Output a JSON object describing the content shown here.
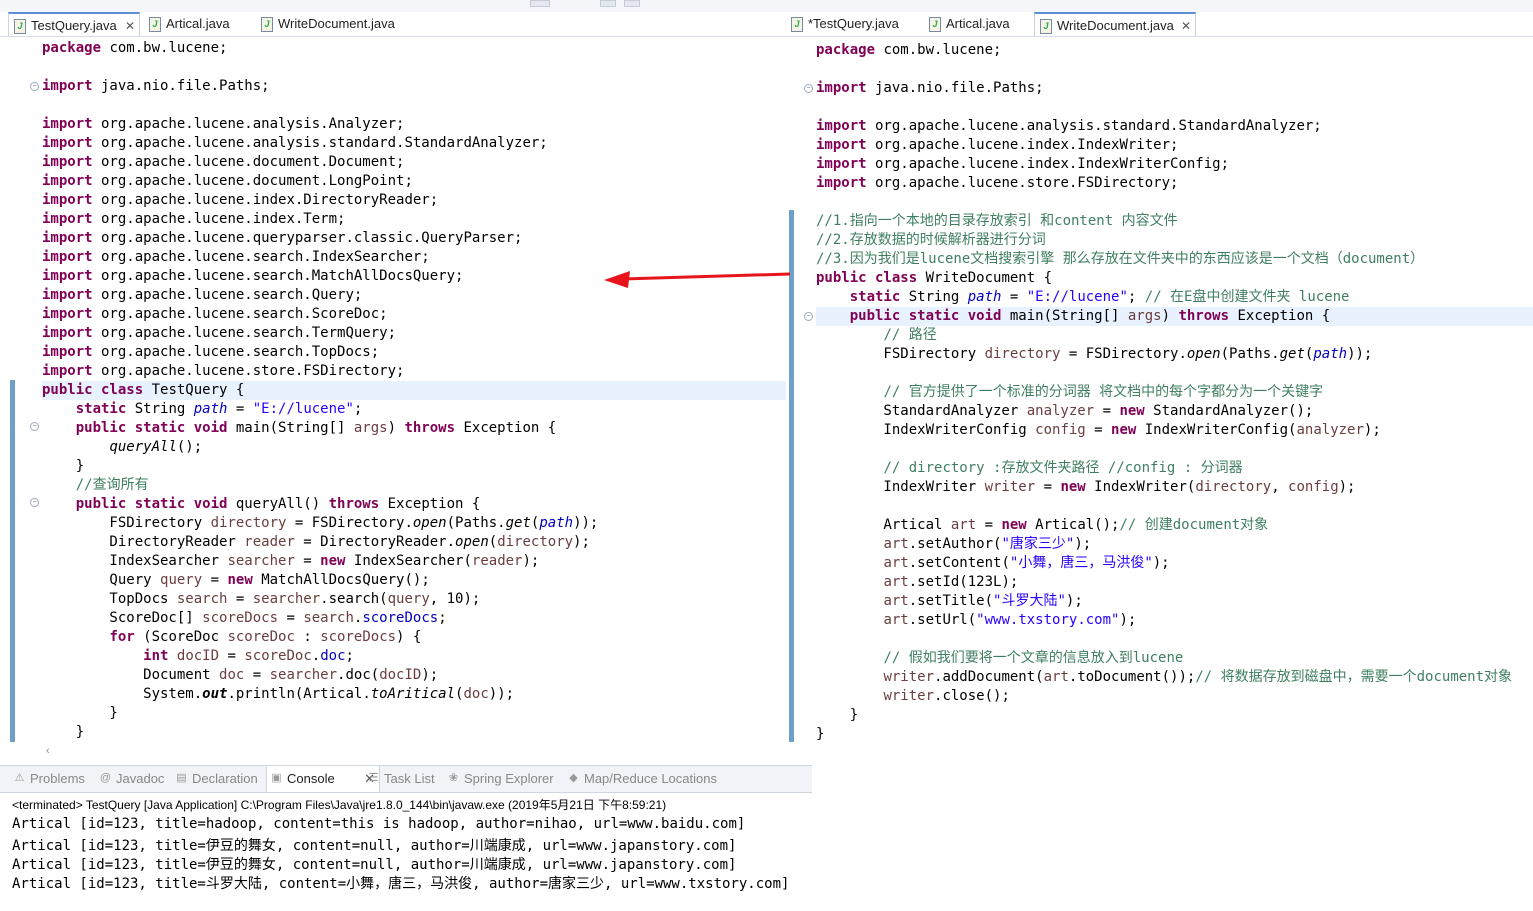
{
  "left_editor": {
    "tabs": [
      {
        "label": "TestQuery.java",
        "active": true,
        "closable": true
      },
      {
        "label": "Artical.java",
        "active": false
      },
      {
        "label": "WriteDocument.java",
        "active": false
      }
    ]
  },
  "right_editor": {
    "tabs": [
      {
        "label": "*TestQuery.java",
        "active": false
      },
      {
        "label": "Artical.java",
        "active": false
      },
      {
        "label": "WriteDocument.java",
        "active": true,
        "closable": true
      }
    ]
  },
  "left_code": [
    [
      [
        "kw",
        "package"
      ],
      [
        "t",
        " com.bw.lucene;"
      ]
    ],
    [],
    [
      [
        "kw",
        "import"
      ],
      [
        "t",
        " java.nio.file.Paths;"
      ]
    ],
    [],
    [
      [
        "kw",
        "import"
      ],
      [
        "t",
        " org.apache.lucene.analysis.Analyzer;"
      ]
    ],
    [
      [
        "kw",
        "import"
      ],
      [
        "t",
        " org.apache.lucene.analysis.standard.StandardAnalyzer;"
      ]
    ],
    [
      [
        "kw",
        "import"
      ],
      [
        "t",
        " org.apache.lucene.document.Document;"
      ]
    ],
    [
      [
        "kw",
        "import"
      ],
      [
        "t",
        " org.apache.lucene.document.LongPoint;"
      ]
    ],
    [
      [
        "kw",
        "import"
      ],
      [
        "t",
        " org.apache.lucene.index.DirectoryReader;"
      ]
    ],
    [
      [
        "kw",
        "import"
      ],
      [
        "t",
        " org.apache.lucene.index.Term;"
      ]
    ],
    [
      [
        "kw",
        "import"
      ],
      [
        "t",
        " org.apache.lucene.queryparser.classic.QueryParser;"
      ]
    ],
    [
      [
        "kw",
        "import"
      ],
      [
        "t",
        " org.apache.lucene.search.IndexSearcher;"
      ]
    ],
    [
      [
        "kw",
        "import"
      ],
      [
        "t",
        " org.apache.lucene.search.MatchAllDocsQuery;"
      ]
    ],
    [
      [
        "kw",
        "import"
      ],
      [
        "t",
        " org.apache.lucene.search.Query;"
      ]
    ],
    [
      [
        "kw",
        "import"
      ],
      [
        "t",
        " org.apache.lucene.search.ScoreDoc;"
      ]
    ],
    [
      [
        "kw",
        "import"
      ],
      [
        "t",
        " org.apache.lucene.search.TermQuery;"
      ]
    ],
    [
      [
        "kw",
        "import"
      ],
      [
        "t",
        " org.apache.lucene.search.TopDocs;"
      ]
    ],
    [
      [
        "kw",
        "import"
      ],
      [
        "t",
        " org.apache.lucene.store.FSDirectory;"
      ]
    ],
    [
      [
        "kw",
        "public class"
      ],
      [
        "t",
        " TestQuery {"
      ]
    ],
    [
      [
        "t",
        "    "
      ],
      [
        "kw",
        "static"
      ],
      [
        "t",
        " String "
      ],
      [
        "fldi",
        "path"
      ],
      [
        "t",
        " = "
      ],
      [
        "str",
        "\"E://lucene\""
      ],
      [
        "t",
        ";"
      ]
    ],
    [
      [
        "t",
        "    "
      ],
      [
        "kw",
        "public static void"
      ],
      [
        "t",
        " main(String[] "
      ],
      [
        "var",
        "args"
      ],
      [
        "t",
        ") "
      ],
      [
        "kw",
        "throws"
      ],
      [
        "t",
        " Exception {"
      ]
    ],
    [
      [
        "t",
        "        "
      ],
      [
        "it",
        "queryAll"
      ],
      [
        "t",
        "();"
      ]
    ],
    [
      [
        "t",
        "    }"
      ]
    ],
    [
      [
        "t",
        "    "
      ],
      [
        "cm",
        "//查询所有"
      ]
    ],
    [
      [
        "t",
        "    "
      ],
      [
        "kw",
        "public static void"
      ],
      [
        "t",
        " queryAll() "
      ],
      [
        "kw",
        "throws"
      ],
      [
        "t",
        " Exception {"
      ]
    ],
    [
      [
        "t",
        "        FSDirectory "
      ],
      [
        "var",
        "directory"
      ],
      [
        "t",
        " = FSDirectory."
      ],
      [
        "it",
        "open"
      ],
      [
        "t",
        "(Paths."
      ],
      [
        "it",
        "get"
      ],
      [
        "t",
        "("
      ],
      [
        "fldi",
        "path"
      ],
      [
        "t",
        "));"
      ]
    ],
    [
      [
        "t",
        "        DirectoryReader "
      ],
      [
        "var",
        "reader"
      ],
      [
        "t",
        " = DirectoryReader."
      ],
      [
        "it",
        "open"
      ],
      [
        "t",
        "("
      ],
      [
        "var",
        "directory"
      ],
      [
        "t",
        ");"
      ]
    ],
    [
      [
        "t",
        "        IndexSearcher "
      ],
      [
        "var",
        "searcher"
      ],
      [
        "t",
        " = "
      ],
      [
        "kw",
        "new"
      ],
      [
        "t",
        " IndexSearcher("
      ],
      [
        "var",
        "reader"
      ],
      [
        "t",
        ");"
      ]
    ],
    [
      [
        "t",
        "        Query "
      ],
      [
        "var",
        "query"
      ],
      [
        "t",
        " = "
      ],
      [
        "kw",
        "new"
      ],
      [
        "t",
        " MatchAllDocsQuery();"
      ]
    ],
    [
      [
        "t",
        "        TopDocs "
      ],
      [
        "var",
        "search"
      ],
      [
        "t",
        " = "
      ],
      [
        "var",
        "searcher"
      ],
      [
        "t",
        ".search("
      ],
      [
        "var",
        "query"
      ],
      [
        "t",
        ", 10);"
      ]
    ],
    [
      [
        "t",
        "        ScoreDoc[] "
      ],
      [
        "var",
        "scoreDocs"
      ],
      [
        "t",
        " = "
      ],
      [
        "var",
        "search"
      ],
      [
        "t",
        "."
      ],
      [
        "fld",
        "scoreDocs"
      ],
      [
        "t",
        ";"
      ]
    ],
    [
      [
        "t",
        "        "
      ],
      [
        "kw",
        "for"
      ],
      [
        "t",
        " (ScoreDoc "
      ],
      [
        "var",
        "scoreDoc"
      ],
      [
        "t",
        " : "
      ],
      [
        "var",
        "scoreDocs"
      ],
      [
        "t",
        ") {"
      ]
    ],
    [
      [
        "t",
        "            "
      ],
      [
        "kw",
        "int"
      ],
      [
        "t",
        " "
      ],
      [
        "var",
        "docID"
      ],
      [
        "t",
        " = "
      ],
      [
        "var",
        "scoreDoc"
      ],
      [
        "t",
        "."
      ],
      [
        "fld",
        "doc"
      ],
      [
        "t",
        ";"
      ]
    ],
    [
      [
        "t",
        "            Document "
      ],
      [
        "var",
        "doc"
      ],
      [
        "t",
        " = "
      ],
      [
        "var",
        "searcher"
      ],
      [
        "t",
        ".doc("
      ],
      [
        "var",
        "docID"
      ],
      [
        "t",
        ");"
      ]
    ],
    [
      [
        "t",
        "            System."
      ],
      [
        "itb",
        "out"
      ],
      [
        "t",
        ".println(Artical."
      ],
      [
        "it",
        "toAritical"
      ],
      [
        "t",
        "("
      ],
      [
        "var",
        "doc"
      ],
      [
        "t",
        "));"
      ]
    ],
    [
      [
        "t",
        "        }"
      ]
    ],
    [
      [
        "t",
        "    }"
      ]
    ]
  ],
  "right_code": [
    [
      [
        "kw",
        "package"
      ],
      [
        "t",
        " com.bw.lucene;"
      ]
    ],
    [],
    [
      [
        "kw",
        "import"
      ],
      [
        "t",
        " java.nio.file.Paths;"
      ]
    ],
    [],
    [
      [
        "kw",
        "import"
      ],
      [
        "t",
        " org.apache.lucene.analysis.standard.StandardAnalyzer;"
      ]
    ],
    [
      [
        "kw",
        "import"
      ],
      [
        "t",
        " org.apache.lucene.index.IndexWriter;"
      ]
    ],
    [
      [
        "kw",
        "import"
      ],
      [
        "t",
        " org.apache.lucene.index.IndexWriterConfig;"
      ]
    ],
    [
      [
        "kw",
        "import"
      ],
      [
        "t",
        " org.apache.lucene.store.FSDirectory;"
      ]
    ],
    [],
    [
      [
        "cm",
        "//1.指向一个本地的目录存放索引 和content 内容文件"
      ]
    ],
    [
      [
        "cm",
        "//2.存放数据的时候解析器进行分词"
      ]
    ],
    [
      [
        "cm",
        "//3.因为我们是lucene文档搜索引擎 那么存放在文件夹中的东西应该是一个文档（document）"
      ]
    ],
    [
      [
        "kw",
        "public class"
      ],
      [
        "t",
        " WriteDocument {"
      ]
    ],
    [
      [
        "t",
        "    "
      ],
      [
        "kw",
        "static"
      ],
      [
        "t",
        " String "
      ],
      [
        "fldi",
        "path"
      ],
      [
        "t",
        " = "
      ],
      [
        "str",
        "\"E://lucene\""
      ],
      [
        "t",
        "; "
      ],
      [
        "cm",
        "// 在E盘中创建文件夹 lucene"
      ]
    ],
    [
      [
        "t",
        "    "
      ],
      [
        "kw",
        "public static void"
      ],
      [
        "t",
        " main(String[] "
      ],
      [
        "var",
        "args"
      ],
      [
        "t",
        ") "
      ],
      [
        "kw",
        "throws"
      ],
      [
        "t",
        " Exception {"
      ]
    ],
    [
      [
        "t",
        "        "
      ],
      [
        "cm",
        "// 路径"
      ]
    ],
    [
      [
        "t",
        "        FSDirectory "
      ],
      [
        "var",
        "directory"
      ],
      [
        "t",
        " = FSDirectory."
      ],
      [
        "it",
        "open"
      ],
      [
        "t",
        "(Paths."
      ],
      [
        "it",
        "get"
      ],
      [
        "t",
        "("
      ],
      [
        "fldi",
        "path"
      ],
      [
        "t",
        "));"
      ]
    ],
    [],
    [
      [
        "t",
        "        "
      ],
      [
        "cm",
        "// 官方提供了一个标准的分词器 将文档中的每个字都分为一个关键字"
      ]
    ],
    [
      [
        "t",
        "        StandardAnalyzer "
      ],
      [
        "var",
        "analyzer"
      ],
      [
        "t",
        " = "
      ],
      [
        "kw",
        "new"
      ],
      [
        "t",
        " StandardAnalyzer();"
      ]
    ],
    [
      [
        "t",
        "        IndexWriterConfig "
      ],
      [
        "var",
        "config"
      ],
      [
        "t",
        " = "
      ],
      [
        "kw",
        "new"
      ],
      [
        "t",
        " IndexWriterConfig("
      ],
      [
        "var",
        "analyzer"
      ],
      [
        "t",
        ");"
      ]
    ],
    [],
    [
      [
        "t",
        "        "
      ],
      [
        "cm",
        "// directory :存放文件夹路径 //config : 分词器"
      ]
    ],
    [
      [
        "t",
        "        IndexWriter "
      ],
      [
        "var",
        "writer"
      ],
      [
        "t",
        " = "
      ],
      [
        "kw",
        "new"
      ],
      [
        "t",
        " IndexWriter("
      ],
      [
        "var",
        "directory"
      ],
      [
        "t",
        ", "
      ],
      [
        "var",
        "config"
      ],
      [
        "t",
        ");"
      ]
    ],
    [],
    [
      [
        "t",
        "        Artical "
      ],
      [
        "var",
        "art"
      ],
      [
        "t",
        " = "
      ],
      [
        "kw",
        "new"
      ],
      [
        "t",
        " Artical();"
      ],
      [
        "cm",
        "// 创建document对象"
      ]
    ],
    [
      [
        "t",
        "        "
      ],
      [
        "var",
        "art"
      ],
      [
        "t",
        ".setAuthor("
      ],
      [
        "str",
        "\"唐家三少\""
      ],
      [
        "t",
        ");"
      ]
    ],
    [
      [
        "t",
        "        "
      ],
      [
        "var",
        "art"
      ],
      [
        "t",
        ".setContent("
      ],
      [
        "str",
        "\"小舞，唐三，马洪俊\""
      ],
      [
        "t",
        ");"
      ]
    ],
    [
      [
        "t",
        "        "
      ],
      [
        "var",
        "art"
      ],
      [
        "t",
        ".setId(123L);"
      ]
    ],
    [
      [
        "t",
        "        "
      ],
      [
        "var",
        "art"
      ],
      [
        "t",
        ".setTitle("
      ],
      [
        "str",
        "\"斗罗大陆\""
      ],
      [
        "t",
        ");"
      ]
    ],
    [
      [
        "t",
        "        "
      ],
      [
        "var",
        "art"
      ],
      [
        "t",
        ".setUrl("
      ],
      [
        "str",
        "\"www.txstory.com\""
      ],
      [
        "t",
        ");"
      ]
    ],
    [],
    [
      [
        "t",
        "        "
      ],
      [
        "cm",
        "// 假如我们要将一个文章的信息放入到lucene"
      ]
    ],
    [
      [
        "t",
        "        "
      ],
      [
        "var",
        "writer"
      ],
      [
        "t",
        ".addDocument("
      ],
      [
        "var",
        "art"
      ],
      [
        "t",
        ".toDocument());"
      ],
      [
        "cm",
        "// 将数据存放到磁盘中，需要一个document对象"
      ]
    ],
    [
      [
        "t",
        "        "
      ],
      [
        "var",
        "writer"
      ],
      [
        "t",
        ".close();"
      ]
    ],
    [
      [
        "t",
        "    }"
      ]
    ],
    [
      [
        "t",
        "}"
      ]
    ]
  ],
  "console": {
    "tabs": [
      {
        "label": "Problems",
        "icon": "problems-icon",
        "glyph": "⚠",
        "active": false
      },
      {
        "label": "Javadoc",
        "icon": "javadoc-icon",
        "glyph": "@",
        "active": false
      },
      {
        "label": "Declaration",
        "icon": "declaration-icon",
        "glyph": "▤",
        "active": false
      },
      {
        "label": "Console",
        "icon": "console-icon",
        "glyph": "▣",
        "active": true,
        "closable": true
      },
      {
        "label": "Task List",
        "icon": "task-list-icon",
        "glyph": "☰",
        "active": false
      },
      {
        "label": "Spring Explorer",
        "icon": "spring-explorer-icon",
        "glyph": "❀",
        "active": false
      },
      {
        "label": "Map/Reduce Locations",
        "icon": "map-reduce-icon",
        "glyph": "◆",
        "active": false
      }
    ],
    "status": "<terminated> TestQuery [Java Application] C:\\Program Files\\Java\\jre1.8.0_144\\bin\\javaw.exe (2019年5月21日 下午8:59:21)",
    "output": [
      "Artical [id=123, title=hadoop, content=this is hadoop, author=nihao, url=www.baidu.com]",
      "Artical [id=123, title=伊豆的舞女, content=null, author=川端康成, url=www.japanstory.com]",
      "Artical [id=123, title=伊豆的舞女, content=null, author=川端康成, url=www.japanstory.com]",
      "Artical [id=123, title=斗罗大陆, content=小舞，唐三，马洪俊, author=唐家三少, url=www.txstory.com]"
    ]
  },
  "colors": {
    "keyword": "#7f0055",
    "string": "#2a00ff",
    "field": "#0000c0",
    "comment": "#3f7f5f",
    "local_variable": "#6a3e3e",
    "annotation_arrow": "#e8141c"
  }
}
